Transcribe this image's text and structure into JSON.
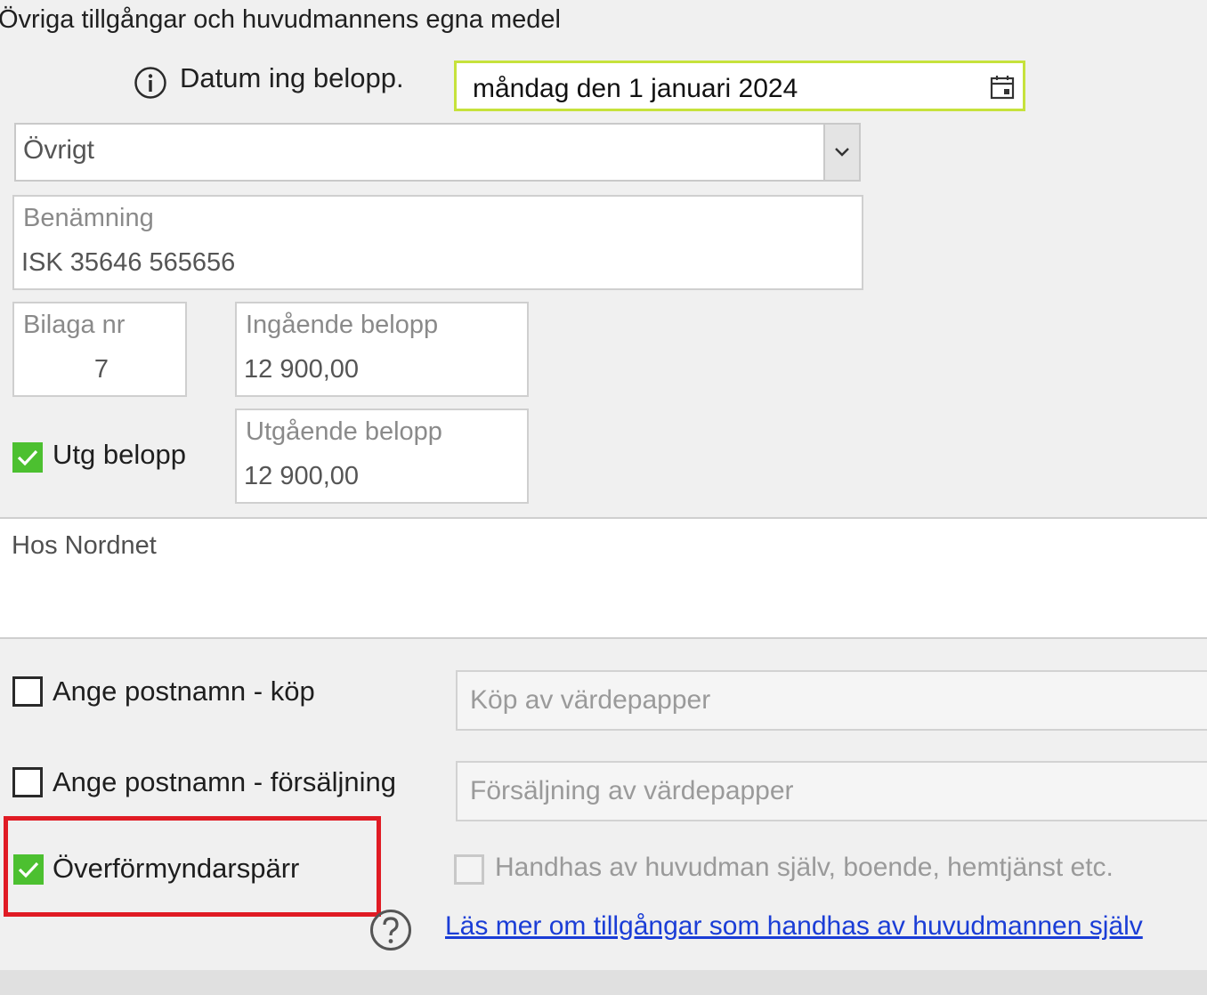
{
  "title": "Övriga tillgångar och huvudmannens egna medel",
  "datum": {
    "label": "Datum ing belopp.",
    "value": "måndag den 1 januari 2024"
  },
  "category": {
    "selected": "Övrigt"
  },
  "benamning": {
    "label": "Benämning",
    "value": "ISK 35646 565656"
  },
  "bilaga": {
    "label": "Bilaga nr",
    "value": "7"
  },
  "ingaende": {
    "label": "Ingående belopp",
    "value": "12 900,00"
  },
  "utgaende": {
    "label": "Utgående belopp",
    "value": "12 900,00"
  },
  "utg_checkbox": {
    "label": "Utg belopp",
    "checked": true
  },
  "notes": {
    "value": "Hos Nordnet"
  },
  "postnamn_kop": {
    "label": "Ange postnamn - köp",
    "checked": false,
    "placeholder": "Köp av värdepapper"
  },
  "postnamn_forsaljning": {
    "label": "Ange postnamn - försäljning",
    "checked": false,
    "placeholder": "Försäljning av värdepapper"
  },
  "overformyndarsparr": {
    "label": "Överförmyndarspärr",
    "checked": true
  },
  "handhas": {
    "label": "Handhas av huvudman själv, boende, hemtjänst etc.",
    "checked": false,
    "disabled": true
  },
  "help_link": "Läs mer om tillgångar som handhas av huvudmannen själv",
  "colors": {
    "accent_green": "#4cc030",
    "date_border": "#c6e23c",
    "highlight_red": "#e01b24",
    "link_blue": "#1a3dd6"
  }
}
